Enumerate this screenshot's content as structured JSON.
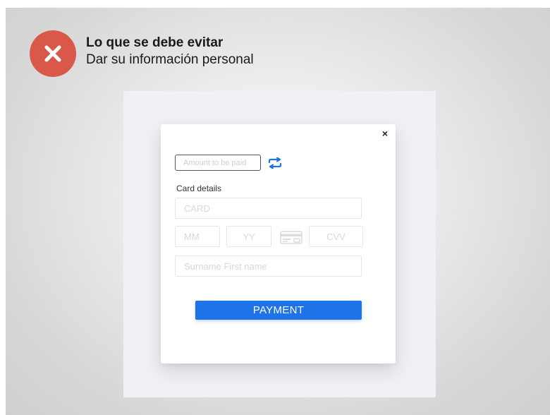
{
  "header": {
    "title": "Lo que se debe evitar",
    "subtitle": "Dar su información personal",
    "icon": "x-circle-icon",
    "badge_color": "#d9584a"
  },
  "form": {
    "close_label": "×",
    "amount_placeholder": "Amount to be paid",
    "swap_icon": "swap-arrows-icon",
    "card_details_label": "Card details",
    "card_placeholder": "CARD",
    "month_placeholder": "MM",
    "year_placeholder": "YY",
    "card_icon": "credit-card-icon",
    "cvv_placeholder": "CVV",
    "name_placeholder": "Surname First name",
    "payment_label": "PAYMENT",
    "accent_color": "#1e73e8"
  }
}
